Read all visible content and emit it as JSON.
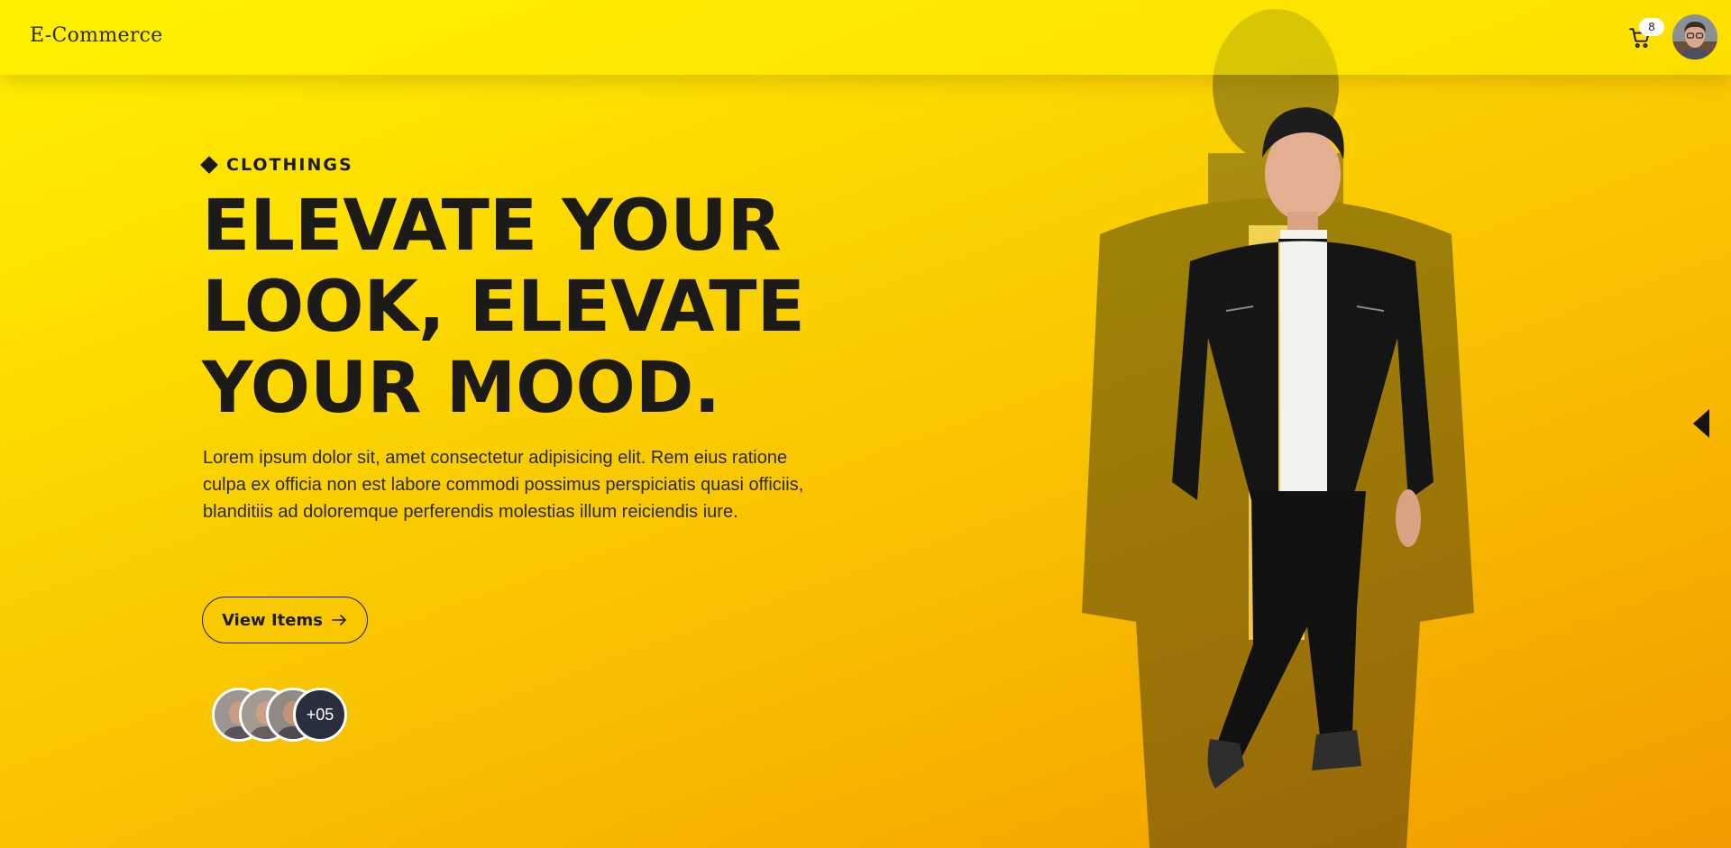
{
  "header": {
    "brand": "E-Commerce",
    "cart_icon": "cart-icon",
    "cart_count": "8",
    "avatar_icon": "user-avatar"
  },
  "hero": {
    "category": "CLOTHINGS",
    "headline_lines": [
      "ELEVATE YOUR",
      "LOOK, ELEVATE",
      "YOUR MOOD."
    ],
    "description": "Lorem ipsum dolor sit, amet consectetur adipisicing elit. Rem eius ratione culpa ex officia non est labore commodi possimus perspiciatis quasi officiis, blanditiis ad doloremque perferendis molestias illum reiciendis iure.",
    "cta_label": "View Items",
    "cta_icon": "arrow-right-icon",
    "customer_avatars_more": "+05",
    "slider_prev_icon": "triangle-left-icon"
  },
  "colors": {
    "background_start": "#fff200",
    "background_end": "#f29a00",
    "text": "#1c1b18",
    "avatar_more_bg": "#2a2f3f"
  }
}
